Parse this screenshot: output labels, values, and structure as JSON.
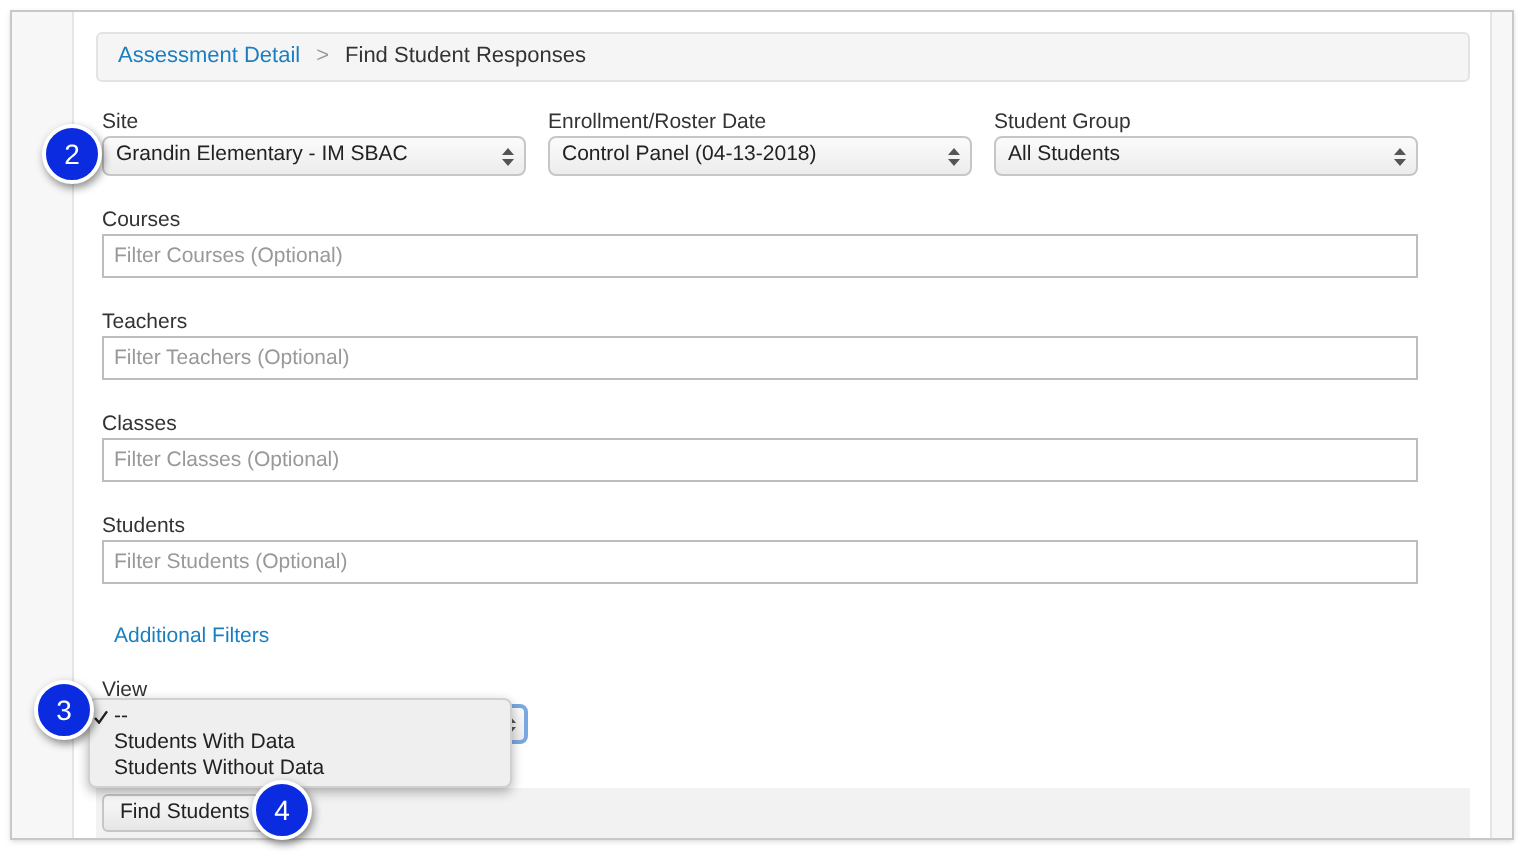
{
  "breadcrumb": [
    {
      "label": "Assessment Detail",
      "kind": "link"
    },
    {
      "label": "Find Student Responses",
      "kind": "current"
    }
  ],
  "breadcrumb_separator": ">",
  "selects": [
    {
      "label": "Site",
      "value": "Grandin Elementary - IM SBAC"
    },
    {
      "label": "Enrollment/Roster Date",
      "value": "Control Panel (04-13-2018)"
    },
    {
      "label": "Student Group",
      "value": "All Students"
    }
  ],
  "filters": [
    {
      "label": "Courses",
      "placeholder": "Filter Courses (Optional)"
    },
    {
      "label": "Teachers",
      "placeholder": "Filter Teachers (Optional)"
    },
    {
      "label": "Classes",
      "placeholder": "Filter Classes (Optional)"
    },
    {
      "label": "Students",
      "placeholder": "Filter Students (Optional)"
    }
  ],
  "additional_filters_link": "Additional Filters",
  "view": {
    "label": "View",
    "expanded": true,
    "options": [
      {
        "label": "--",
        "selected": true
      },
      {
        "label": "Students With Data",
        "selected": false
      },
      {
        "label": "Students Without Data",
        "selected": false
      }
    ]
  },
  "find_button": "Find Students",
  "callouts": [
    "2",
    "3",
    "4"
  ]
}
